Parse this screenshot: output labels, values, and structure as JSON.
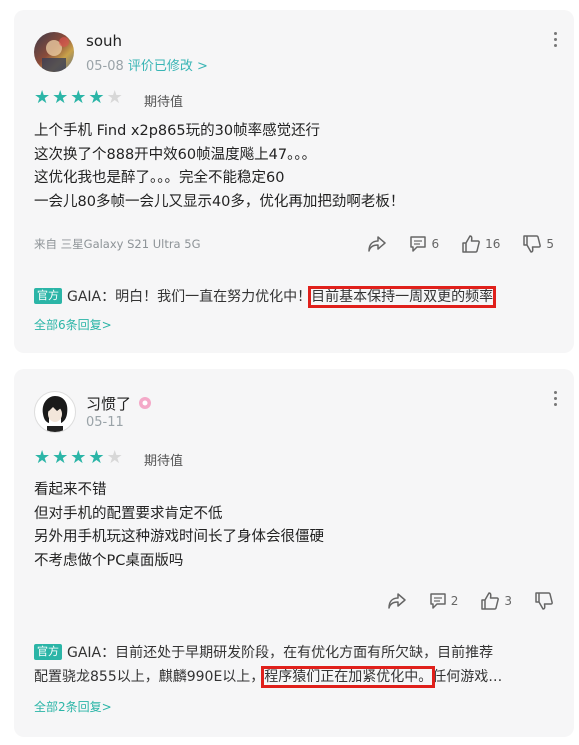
{
  "reviews": [
    {
      "username": "souh",
      "date": "05-08",
      "edit_note": "评价已修改 >",
      "stars_filled": 4,
      "stars_total": 5,
      "rating_label": "期待值",
      "lines": [
        "上个手机 Find x2p865玩的30帧率感觉还行",
        "这次换了个888开中效60帧温度飚上47。。。",
        "这优化我也是醉了。。。完全不能稳定60",
        "一会儿80多帧一会儿又显示40多，优化再加把劲啊老板！"
      ],
      "device": "来自 三星Galaxy S21 Ultra 5G",
      "comments": "6",
      "likes": "16",
      "dislikes": "5",
      "reply_tag": "官方",
      "reply_text": "GAIA：明白！我们一直在努力优化中！",
      "reply_highlight": "目前基本保持一周双更的频率",
      "more_replies": "全部6条回复>"
    },
    {
      "username": "习惯了",
      "date": "05-11",
      "stars_filled": 4,
      "stars_total": 5,
      "rating_label": "期待值",
      "lines": [
        "看起来不错",
        "但对手机的配置要求肯定不低",
        "另外用手机玩这种游戏时间长了身体会很僵硬",
        "不考虑做个PC桌面版吗"
      ],
      "comments": "2",
      "likes": "3",
      "reply_tag": "官方",
      "reply_text_1": "GAIA：目前还处于早期研发阶段，在有优化方面有所欠缺，目前推荐",
      "reply_text_2a": "配置骁龙855以上，麒麟990E以上，",
      "reply_highlight": "程序猿们正在加紧优化中。",
      "reply_text_2b": "任何游戏…",
      "more_replies": "全部2条回复>"
    }
  ],
  "colors": {
    "accent": "#2bb5a7",
    "highlight_box": "#e0201b",
    "card_bg": "#f6f6f7"
  }
}
